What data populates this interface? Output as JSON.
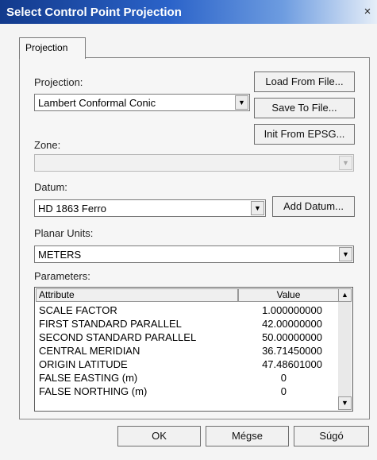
{
  "window": {
    "title": "Select Control Point Projection",
    "close_glyph": "×"
  },
  "tab": {
    "label": "Projection"
  },
  "projection": {
    "label": "Projection:",
    "value": "Lambert Conformal Conic"
  },
  "buttons": {
    "load": "Load From File...",
    "save": "Save To File...",
    "init": "Init From EPSG...",
    "add_datum": "Add Datum..."
  },
  "zone": {
    "label": "Zone:",
    "value": ""
  },
  "datum": {
    "label": "Datum:",
    "value": "HD 1863 Ferro"
  },
  "planar_units": {
    "label": "Planar Units:",
    "value": "METERS"
  },
  "parameters": {
    "label": "Parameters:",
    "columns": [
      "Attribute",
      "Value"
    ],
    "rows": [
      {
        "attribute": "SCALE FACTOR",
        "value": "1.000000000"
      },
      {
        "attribute": "FIRST STANDARD PARALLEL",
        "value": "42.00000000"
      },
      {
        "attribute": "SECOND STANDARD PARALLEL",
        "value": "50.00000000"
      },
      {
        "attribute": "CENTRAL MERIDIAN",
        "value": "36.71450000"
      },
      {
        "attribute": "ORIGIN LATITUDE",
        "value": "47.48601000"
      },
      {
        "attribute": "FALSE EASTING (m)",
        "value": "0"
      },
      {
        "attribute": "FALSE NORTHING (m)",
        "value": "0"
      }
    ]
  },
  "footer": {
    "ok": "OK",
    "cancel": "Mégse",
    "help": "Súgó"
  }
}
